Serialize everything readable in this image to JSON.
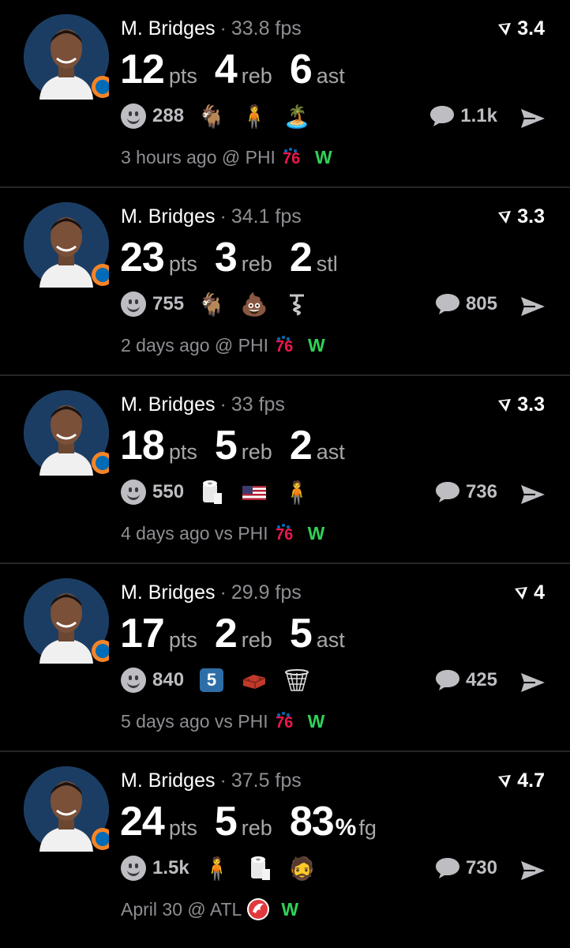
{
  "colors": {
    "background": "#000000",
    "win": "#30d158",
    "muted": "#8e8e93",
    "divider": "#262626"
  },
  "posts": [
    {
      "player": "M. Bridges",
      "fps": "33.8 fps",
      "score": "3.4",
      "stats": [
        {
          "num": "12",
          "unit": "pts"
        },
        {
          "num": "4",
          "unit": "reb"
        },
        {
          "num": "6",
          "unit": "ast"
        }
      ],
      "reactions": "288",
      "emojis": [
        "goat-emoji",
        "person-emoji",
        "island-emoji"
      ],
      "comments": "1.1k",
      "time": "3 hours ago @ PHI",
      "team_logo": "76ers-logo",
      "result": "W"
    },
    {
      "player": "M. Bridges",
      "fps": "34.1 fps",
      "score": "3.3",
      "stats": [
        {
          "num": "23",
          "unit": "pts"
        },
        {
          "num": "3",
          "unit": "reb"
        },
        {
          "num": "2",
          "unit": "stl"
        }
      ],
      "reactions": "755",
      "emojis": [
        "goat-emoji",
        "poop-emoji",
        "corkscrew-emoji"
      ],
      "comments": "805",
      "time": "2 days ago @ PHI",
      "team_logo": "76ers-logo",
      "result": "W"
    },
    {
      "player": "M. Bridges",
      "fps": "33 fps",
      "score": "3.3",
      "stats": [
        {
          "num": "18",
          "unit": "pts"
        },
        {
          "num": "5",
          "unit": "reb"
        },
        {
          "num": "2",
          "unit": "ast"
        }
      ],
      "reactions": "550",
      "emojis": [
        "toilet-paper-emoji",
        "us-flag-emoji",
        "person-emoji"
      ],
      "comments": "736",
      "time": "4 days ago vs PHI",
      "team_logo": "76ers-logo",
      "result": "W"
    },
    {
      "player": "M. Bridges",
      "fps": "29.9 fps",
      "score": "4",
      "stats": [
        {
          "num": "17",
          "unit": "pts"
        },
        {
          "num": "2",
          "unit": "reb"
        },
        {
          "num": "5",
          "unit": "ast"
        }
      ],
      "reactions": "840",
      "badge": "5",
      "emojis": [
        "number-five-emoji",
        "brick-emoji",
        "hoop-emoji"
      ],
      "comments": "425",
      "time": "5 days ago vs PHI",
      "team_logo": "76ers-logo",
      "result": "W"
    },
    {
      "player": "M. Bridges",
      "fps": "37.5 fps",
      "score": "4.7",
      "stats": [
        {
          "num": "24",
          "unit": "pts"
        },
        {
          "num": "5",
          "unit": "reb"
        },
        {
          "num": "83",
          "pct": "%",
          "unit": "fg"
        }
      ],
      "reactions": "1.5k",
      "emojis": [
        "person-emoji",
        "toilet-paper-emoji",
        "person-emoji"
      ],
      "comments": "730",
      "time": "April 30 @ ATL",
      "team_logo": "hawks-logo",
      "result": "W"
    }
  ]
}
